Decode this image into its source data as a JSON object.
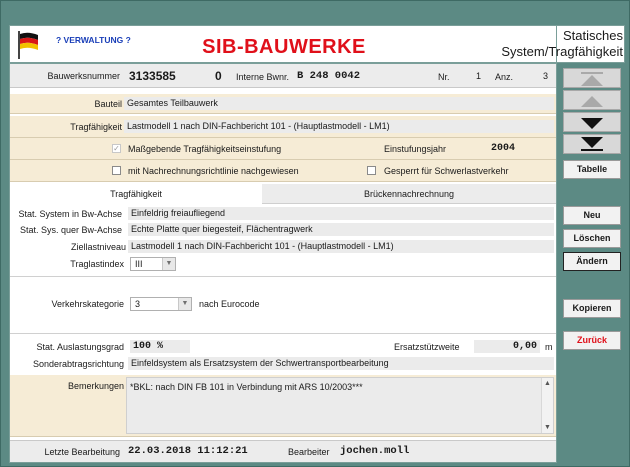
{
  "header": {
    "help_link": "? VERWALTUNG ?",
    "app_title": "SIB-BAUWERKE",
    "section_line1": "Statisches",
    "section_line2": "System/Tragfähigkeit"
  },
  "record": {
    "bauwerksnummer_label": "Bauwerksnummer",
    "bauwerksnummer": "3133585",
    "teil": "0",
    "interne_label": "Interne Bwnr.",
    "interne_value": "B 248 0042",
    "nr_label": "Nr.",
    "nr_value": "1",
    "anz_label": "Anz.",
    "anz_value": "3"
  },
  "bauteil": {
    "label": "Bauteil",
    "value": "Gesamtes Teilbauwerk"
  },
  "tragfaehigkeit": {
    "label": "Tragfähigkeit",
    "value": "Lastmodell 1 nach DIN-Fachbericht 101 -  (Hauptlastmodell - LM1)"
  },
  "flags": {
    "massgebende_label": "Maßgebende Tragfähigkeitseinstufung",
    "massgebende_checked": "✓",
    "einstufungsjahr_label": "Einstufungsjahr",
    "einstufungsjahr": "2004",
    "nachrechnung_label": "mit Nachrechnungsrichtlinie nachgewiesen",
    "gesperrt_label": "Gesperrt für Schwerlastverkehr"
  },
  "tabs": [
    {
      "label": "Tragfähigkeit"
    },
    {
      "label": "Brückennachrechnung"
    }
  ],
  "details": {
    "system_bw_label": "Stat. System in Bw-Achse",
    "system_bw": "Einfeldrig freiaufliegend",
    "system_quer_label": "Stat. Sys. quer Bw-Achse",
    "system_quer": "Echte Platte quer biegesteif, Flächentragwerk",
    "ziellast_label": "Ziellastniveau",
    "ziellast": "Lastmodell 1 nach DIN-Fachbericht 101 -  (Hauptlastmodell - LM1)",
    "traglastindex_label": "Traglastindex",
    "traglastindex": "III"
  },
  "verkehr": {
    "label": "Verkehrskategorie",
    "value": "3",
    "suffix": "nach Eurocode"
  },
  "auslastung": {
    "label": "Stat. Auslastungsgrad",
    "value": "100 %",
    "ersatz_label": "Ersatzstützweite",
    "ersatz_value": "0,00",
    "ersatz_unit": "m"
  },
  "sonder": {
    "label": "Sonderabtragsrichtung",
    "value": "Einfeldsystem als Ersatzsystem der Schwertransportbearbeitung"
  },
  "bemerkungen": {
    "label": "Bemerkungen",
    "value": "*BKL: nach DIN FB 101 in Verbindung mit ARS 10/2003***"
  },
  "footer": {
    "letzte_label": "Letzte Bearbeitung",
    "letzte_value": "22.03.2018 11:12:21",
    "bearbeiter_label": "Bearbeiter",
    "bearbeiter_value": "jochen.moll"
  },
  "sidebar": {
    "tabelle": "Tabelle",
    "neu": "Neu",
    "loeschen": "Löschen",
    "aendern": "Ändern",
    "kopieren": "Kopieren",
    "zurueck": "Zurück"
  },
  "colors": {
    "accent_red": "#e0101a",
    "frame_teal": "#5c8a84",
    "row_beige": "#f6ecd6",
    "link_blue": "#1a3fb8"
  }
}
